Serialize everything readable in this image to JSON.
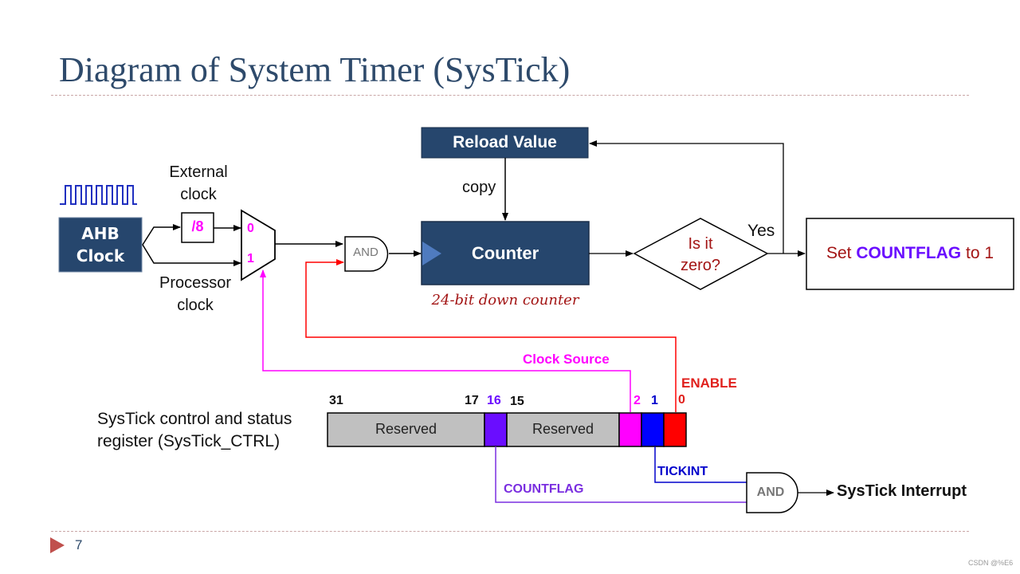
{
  "slide": {
    "title": "Diagram of System Timer (SysTick)",
    "page_number": "7",
    "watermark": "CSDN @%E6"
  },
  "diagram": {
    "ahb_clock": {
      "line1": "AHB",
      "line2": "Clock"
    },
    "external_clock": {
      "line1": "External",
      "line2": "clock"
    },
    "processor_clock": {
      "line1": "Processor",
      "line2": "clock"
    },
    "divider": "/8",
    "mux_inputs": [
      "0",
      "1"
    ],
    "and_gate_enable": "AND",
    "reload_value": "Reload Value",
    "copy_label": "copy",
    "counter": "Counter",
    "counter_caption": "24-bit down counter",
    "decision": {
      "line1": "Is it",
      "line2": "zero?"
    },
    "yes_label": "Yes",
    "countflag_box": {
      "prefix": "Set ",
      "keyword": "COUNTFLAG",
      "suffix": " to 1"
    },
    "register_label": {
      "line1": "SysTick control and status",
      "line2": "register (SysTick_CTRL)"
    },
    "bit_numbers": {
      "b31": "31",
      "b17": "17",
      "b16": "16",
      "b15": "15",
      "b2": "2",
      "b1": "1",
      "b0": "0"
    },
    "fields": {
      "reserved_high": "Reserved",
      "reserved_low": "Reserved"
    },
    "signals": {
      "clock_source": "Clock Source",
      "enable": "ENABLE",
      "tickint": "TICKINT",
      "countflag": "COUNTFLAG"
    },
    "and_gate_interrupt": "AND",
    "interrupt_output": "SysTick Interrupt"
  },
  "colors": {
    "navy": "#26466d",
    "clock_wave": "#1f2fc0",
    "magenta": "#ff00ff",
    "enable_red": "#ff0000",
    "enable_text": "#e0201c",
    "tickint_blue": "#0000ff",
    "countflag_purple": "#6a0dff",
    "dark_red_text": "#a31515",
    "reserved_gray": "#c0c0c0"
  }
}
